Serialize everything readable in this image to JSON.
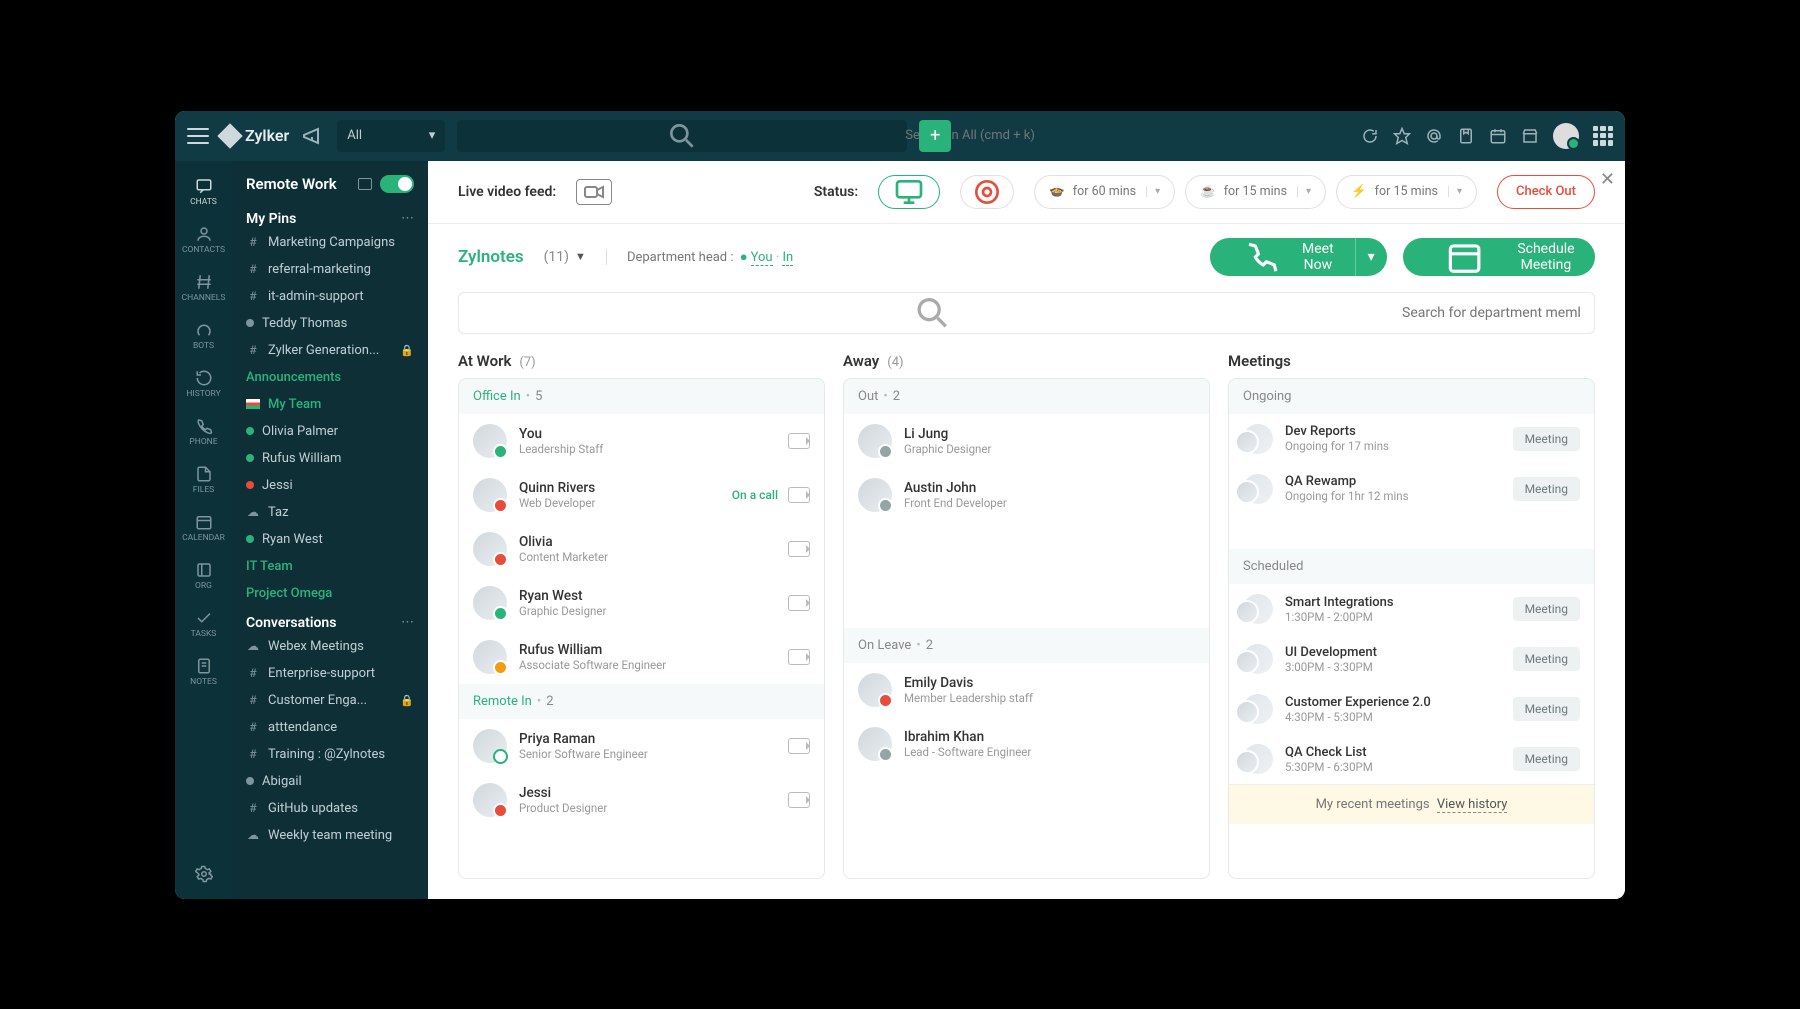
{
  "brand": "Zylker",
  "filter_selected": "All",
  "search_placeholder": "Search in All (cmd + k)",
  "rail": [
    {
      "label": "CHATS"
    },
    {
      "label": "CONTACTS"
    },
    {
      "label": "CHANNELS"
    },
    {
      "label": "BOTS"
    },
    {
      "label": "HISTORY"
    },
    {
      "label": "PHONE"
    },
    {
      "label": "FILES"
    },
    {
      "label": "CALENDAR"
    },
    {
      "label": "ORG"
    },
    {
      "label": "TASKS"
    },
    {
      "label": "NOTES"
    }
  ],
  "sidebar": {
    "header": "Remote Work",
    "sections": {
      "pins": {
        "title": "My Pins",
        "items": [
          {
            "icon": "#",
            "label": "Marketing Campaigns"
          },
          {
            "icon": "#",
            "label": "referral-marketing"
          },
          {
            "icon": "#",
            "label": "it-admin-support"
          },
          {
            "icon": "dot-grey",
            "label": "Teddy Thomas"
          },
          {
            "icon": "#",
            "label": "Zylker Generation...",
            "locked": true
          }
        ]
      },
      "announcements": {
        "title": "Announcements"
      },
      "myteam": {
        "title": "My Team",
        "items": [
          {
            "icon": "dot-green",
            "label": "Olivia Palmer"
          },
          {
            "icon": "dot-green",
            "label": "Rufus William"
          },
          {
            "icon": "dot-red",
            "label": "Jessi"
          },
          {
            "icon": "cloud",
            "label": "Taz"
          },
          {
            "icon": "dot-green",
            "label": "Ryan West"
          }
        ]
      },
      "itteam": {
        "title": "IT Team"
      },
      "omega": {
        "title": "Project Omega"
      },
      "conversations": {
        "title": "Conversations",
        "items": [
          {
            "icon": "cloud",
            "label": "Webex Meetings"
          },
          {
            "icon": "#",
            "label": "Enterprise-support"
          },
          {
            "icon": "#",
            "label": "Customer Enga...",
            "locked": true
          },
          {
            "icon": "#",
            "label": "atttendance"
          },
          {
            "icon": "#",
            "label": "Training : @Zylnotes"
          },
          {
            "icon": "dot-grey",
            "label": "Abigail"
          },
          {
            "icon": "#",
            "label": "GitHub updates"
          },
          {
            "icon": "cloud",
            "label": "Weekly team meeting"
          }
        ]
      }
    }
  },
  "statusbar": {
    "live_feed": "Live video feed:",
    "status_label": "Status:",
    "timers": [
      {
        "icon": "soup",
        "text": "for 60 mins",
        "color": "#f39c12"
      },
      {
        "icon": "coffee",
        "text": "for 15 mins",
        "color": "#f39c12"
      },
      {
        "icon": "quick",
        "text": "for 15 mins",
        "color": "#e74c3c"
      }
    ],
    "checkout": "Check Out"
  },
  "dept": {
    "name": "Zylnotes",
    "count": "(11)",
    "head_label": "Department head :",
    "head_you": "You",
    "head_status": "In",
    "meet_now": "Meet Now",
    "schedule": "Schedule Meeting",
    "search_placeholder": "Search for department members"
  },
  "columns": {
    "atwork": {
      "title": "At Work",
      "count": "(7)",
      "office_in": {
        "label": "Office In",
        "count": "5"
      },
      "remote_in": {
        "label": "Remote In",
        "count": "2"
      },
      "office": [
        {
          "name": "You",
          "role": "Leadership Staff",
          "st": "green",
          "cam": true
        },
        {
          "name": "Quinn Rivers",
          "role": "Web Developer",
          "st": "red",
          "oncall": "On a call",
          "cam": true
        },
        {
          "name": "Olivia",
          "role": "Content Marketer",
          "st": "red",
          "cam": true
        },
        {
          "name": "Ryan West",
          "role": "Graphic Designer",
          "st": "green",
          "cam": true
        },
        {
          "name": "Rufus William",
          "role": "Associate Software Engineer",
          "st": "orange",
          "cam": true
        }
      ],
      "remote": [
        {
          "name": "Priya Raman",
          "role": "Senior Software Engineer",
          "st": "ring",
          "cam": true
        },
        {
          "name": "Jessi",
          "role": "Product Designer",
          "st": "red",
          "cam": true
        }
      ]
    },
    "away": {
      "title": "Away",
      "count": "(4)",
      "out": {
        "label": "Out",
        "count": "2"
      },
      "leave": {
        "label": "On Leave",
        "count": "2"
      },
      "out_list": [
        {
          "name": "Li Jung",
          "role": "Graphic Designer",
          "st": "grey"
        },
        {
          "name": "Austin John",
          "role": "Front End Developer",
          "st": "grey"
        }
      ],
      "leave_list": [
        {
          "name": "Emily Davis",
          "role": "Member Leadership staff",
          "st": "red"
        },
        {
          "name": "Ibrahim Khan",
          "role": "Lead - Software Engineer",
          "st": "grey"
        }
      ]
    },
    "meetings": {
      "title": "Meetings",
      "ongoing_label": "Ongoing",
      "scheduled_label": "Scheduled",
      "ongoing": [
        {
          "name": "Dev Reports",
          "time": "Ongoing for 17 mins",
          "btn": "Meeting"
        },
        {
          "name": "QA Rewamp",
          "time": "Ongoing for 1hr 12 mins",
          "btn": "Meeting"
        }
      ],
      "scheduled": [
        {
          "name": "Smart Integrations",
          "time": "1:30PM - 2:00PM",
          "btn": "Meeting"
        },
        {
          "name": "UI Development",
          "time": "3:00PM - 3:30PM",
          "btn": "Meeting"
        },
        {
          "name": "Customer Experience 2.0",
          "time": "4:30PM - 5:30PM",
          "btn": "Meeting"
        },
        {
          "name": "QA Check List",
          "time": "5:30PM - 6:30PM",
          "btn": "Meeting"
        }
      ],
      "recent": "My recent meetings",
      "view_history": "View history"
    }
  }
}
